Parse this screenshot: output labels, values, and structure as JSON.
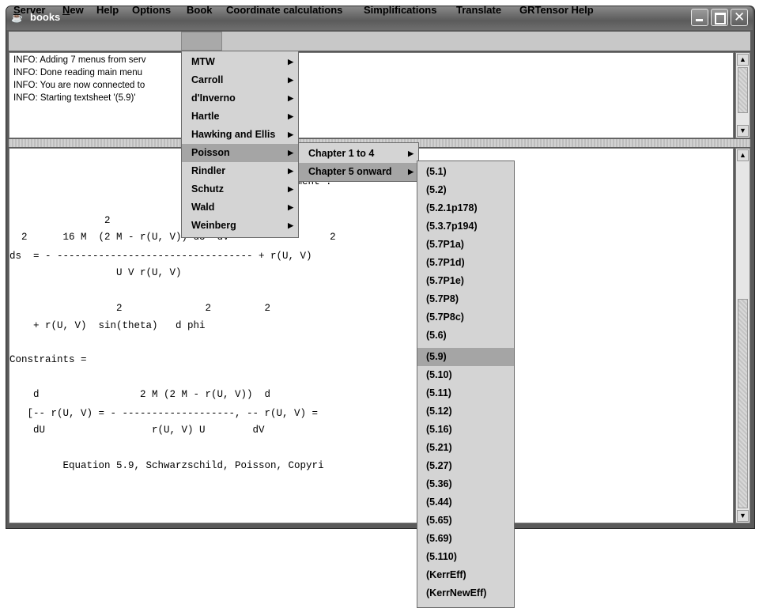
{
  "window": {
    "title": "books"
  },
  "menubar": [
    {
      "label": "Server",
      "mnemonic": "S",
      "rest": "erver"
    },
    {
      "label": "New",
      "mnemonic": "N",
      "rest": "ew"
    },
    {
      "label": "Help"
    },
    {
      "label": "Options"
    },
    {
      "label": "Book"
    },
    {
      "label": "Coordinate calculations"
    },
    {
      "label": "Simplifications"
    },
    {
      "label": "Translate"
    },
    {
      "label": "GRTensor Help"
    }
  ],
  "info_pane": {
    "lines": [
      "INFO: Adding 7 menus from serv",
      "INFO: Done reading main menu",
      "INFO: You are now connected to",
      "INFO: Starting textsheet '(5.9)'"
    ]
  },
  "main_pane": {
    "lines": [
      "element :",
      "                2",
      "  2      16 M  (2 M - r(U, V)) dU  dV                 2",
      "ds  = - --------------------------------- + r(U, V)",
      "                  U V r(U, V)",
      "                  2              2         2",
      "    + r(U, V)  sin(theta)   d phi",
      "Constraints =",
      "    d                 2 M (2 M - r(U, V))  d                         r(U, V))",
      "   [-- r(U, V) = - -------------------, -- r(U, V) =                  ---------]",
      "    dU                  r(U, V) U        dV                          V) V",
      "         Equation 5.9, Schwarzschild, Poisson, Copyri                .org"
    ]
  },
  "menus": {
    "book": [
      "MTW",
      "Carroll",
      "d'Inverno",
      "Hartle",
      "Hawking and Ellis",
      "Poisson",
      "Rindler",
      "Schutz",
      "Wald",
      "Weinberg"
    ],
    "book_selected": "Poisson",
    "poisson": [
      "Chapter 1 to 4",
      "Chapter 5 onward"
    ],
    "poisson_selected": "Chapter 5 onward",
    "chapter5": [
      "(5.1)",
      "(5.2)",
      "(5.2.1p178)",
      "(5.3.7p194)",
      "(5.7P1a)",
      "(5.7P1d)",
      "(5.7P1e)",
      "(5.7P8)",
      "(5.7P8c)",
      "(5.6)",
      "(5.9)",
      "(5.10)",
      "(5.11)",
      "(5.12)",
      "(5.16)",
      "(5.21)",
      "(5.27)",
      "(5.36)",
      "(5.44)",
      "(5.65)",
      "(5.69)",
      "(5.110)",
      "(KerrEff)",
      "(KerrNewEff)"
    ],
    "chapter5_selected": "(5.9)"
  },
  "colors": {
    "menu_bg": "#d4d4d4",
    "highlight": "#a5a5a5",
    "titlebar": "#6a6a6a"
  }
}
